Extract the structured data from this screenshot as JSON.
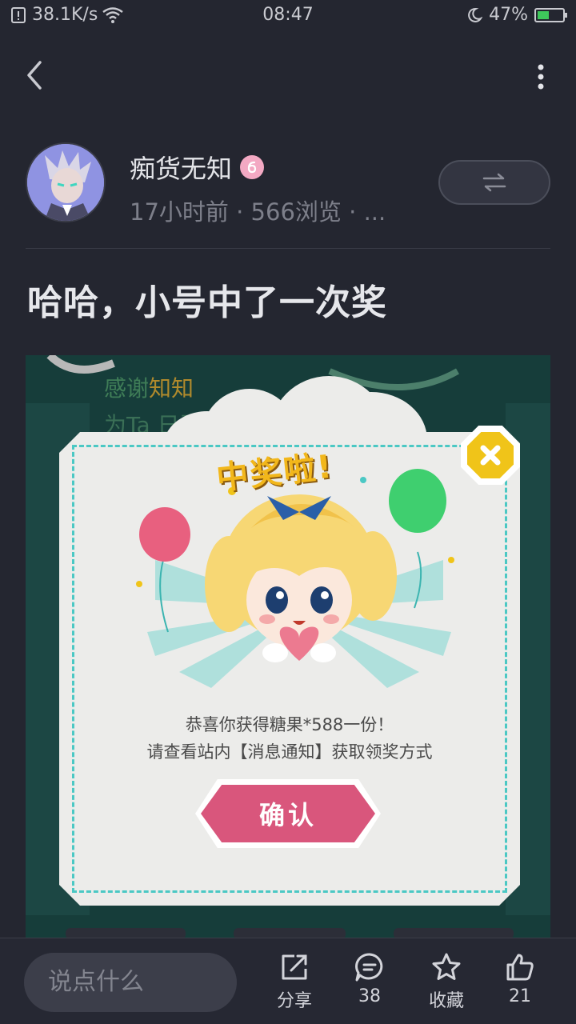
{
  "status_bar": {
    "net_speed": "38.1K/s",
    "time": "08:47",
    "battery": "47%",
    "battery_level": 0.47
  },
  "post": {
    "author_name": "痴货无知",
    "meta": "17小时前 · 566浏览 · ...",
    "title": "哈哈，小号中了一次奖"
  },
  "image": {
    "bg_text_line1_a": "感谢",
    "bg_text_line1_b": "知知",
    "bg_text_line2": "为Ta                 日蛋糕！"
  },
  "popup": {
    "heading": "中奖啦!",
    "message_line1": "恭喜你获得糖果*588一份！",
    "message_line2": "请查看站内【消息通知】获取领奖方式",
    "confirm_label": "确认"
  },
  "bottom_bar": {
    "comment_placeholder": "说点什么",
    "share_label": "分享",
    "comments_count": "38",
    "favorite_label": "收藏",
    "likes_count": "21"
  },
  "colors": {
    "background": "#242630",
    "popup_accent": "#4bc8c4",
    "confirm_button": "#d9567c",
    "heading_yellow": "#f2b71b"
  }
}
